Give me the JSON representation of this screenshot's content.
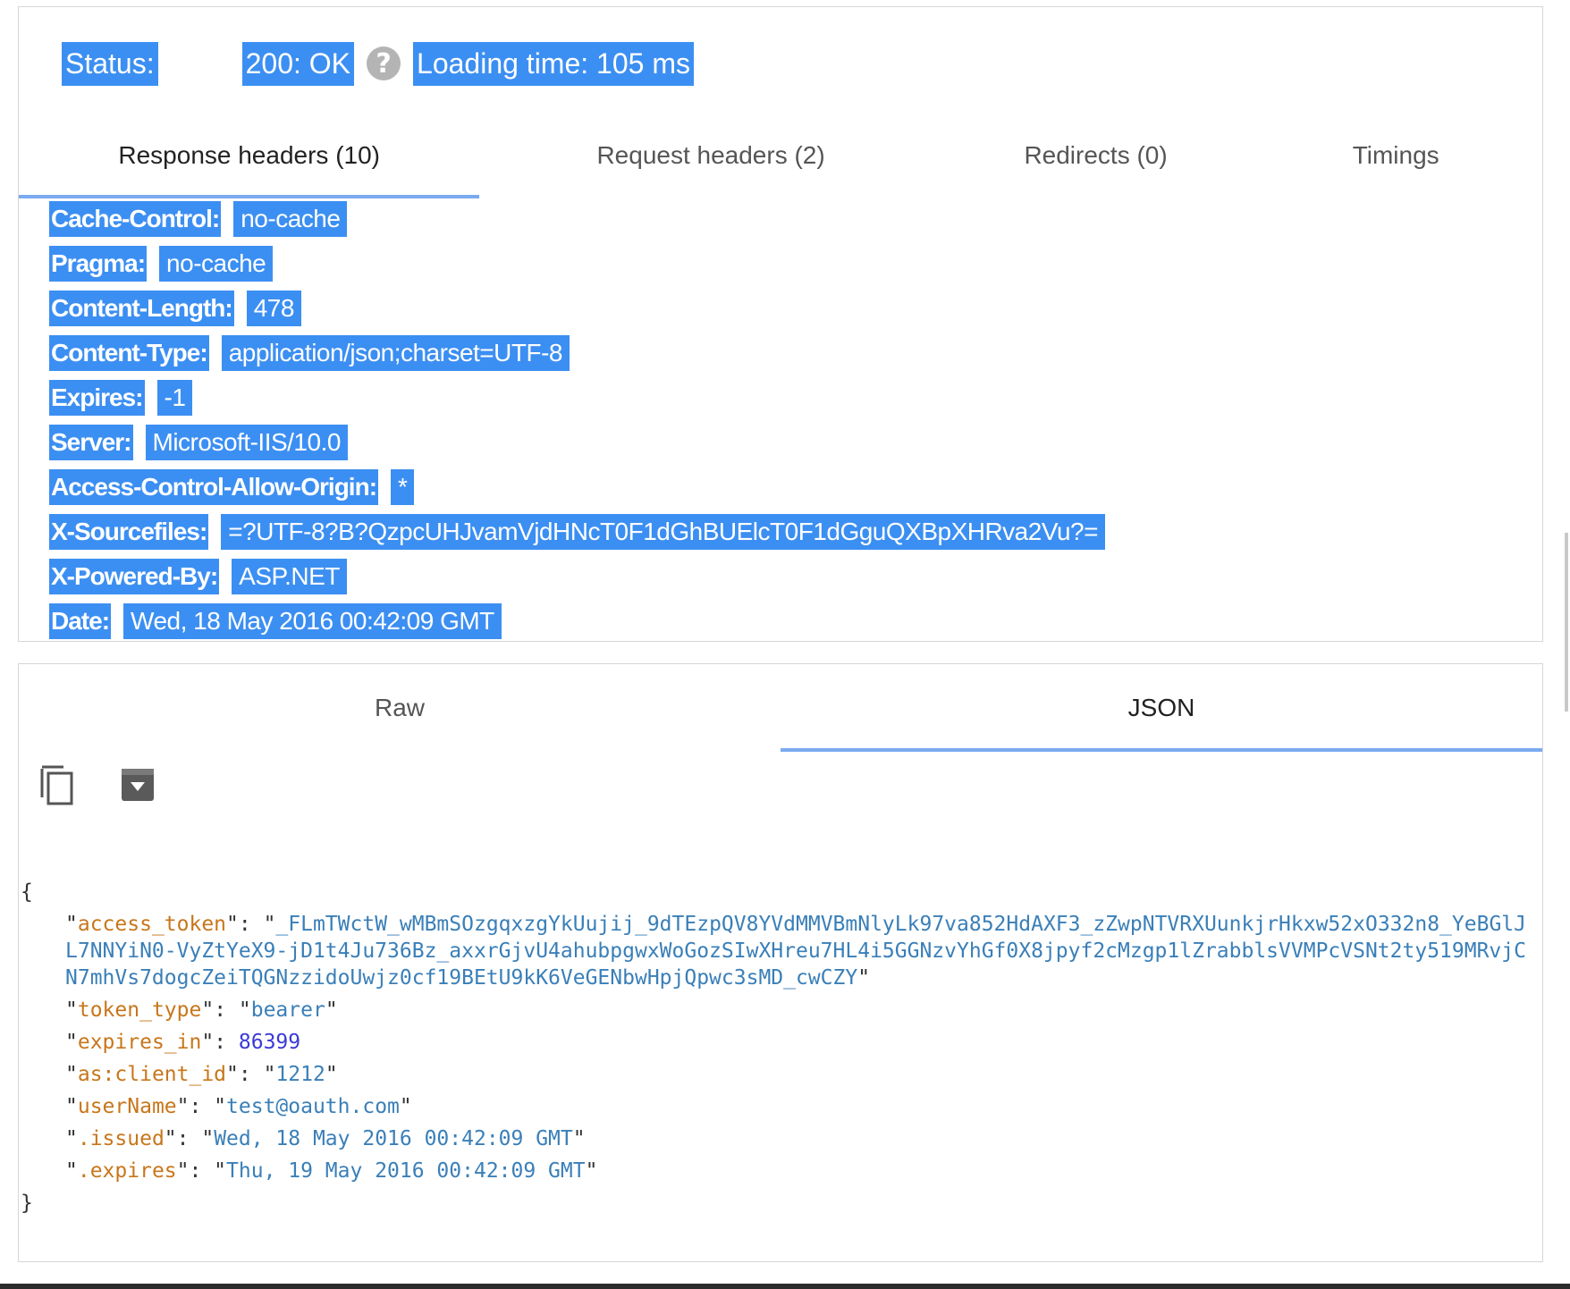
{
  "status": {
    "label": "Status:",
    "code": "200: OK",
    "help_glyph": "?",
    "loading_time": "Loading time: 105 ms"
  },
  "header_tabs": [
    {
      "label": "Response headers (10)",
      "active": true
    },
    {
      "label": "Request headers (2)",
      "active": false
    },
    {
      "label": "Redirects (0)",
      "active": false
    },
    {
      "label": "Timings",
      "active": false
    }
  ],
  "response_headers": [
    {
      "name": "Cache-Control:",
      "value": "no-cache"
    },
    {
      "name": "Pragma:",
      "value": "no-cache"
    },
    {
      "name": "Content-Length:",
      "value": "478"
    },
    {
      "name": "Content-Type:",
      "value": "application/json;charset=UTF-8"
    },
    {
      "name": "Expires:",
      "value": "-1"
    },
    {
      "name": "Server:",
      "value": "Microsoft-IIS/10.0"
    },
    {
      "name": "Access-Control-Allow-Origin:",
      "value": "*"
    },
    {
      "name": "X-Sourcefiles:",
      "value": "=?UTF-8?B?QzpcUHJvamVjdHNcT0F1dGhBUElcT0F1dGguQXBpXHRva2Vu?="
    },
    {
      "name": "X-Powered-By:",
      "value": "ASP.NET"
    },
    {
      "name": "Date:",
      "value": "Wed, 18 May 2016 00:42:09 GMT"
    }
  ],
  "body_tabs": [
    {
      "label": "Raw",
      "active": false
    },
    {
      "label": "JSON",
      "active": true
    }
  ],
  "tools": {
    "copy_icon": "copy-icon",
    "save_icon": "save-icon"
  },
  "json_body": {
    "open_brace": "{",
    "close_brace": "}",
    "entries": [
      {
        "key": "access_token",
        "value": "_FLmTWctW_wMBmSOzgqxzgYkUujij_9dTEzpQV8YVdMMVBmNlyLk97va852HdAXF3_zZwpNTVRXUunkjrHkxw52xO332n8_YeBGlJL7NNYiN0-VyZtYeX9-jD1t4Ju736Bz_axxrGjvU4ahubpgwxWoGozSIwXHreu7HL4i5GGNzvYhGf0X8jpyf2cMzgp1lZrabblsVVMPcVSNt2ty519MRvjCN7mhVs7dogcZeiTQGNzzidoUwjz0cf19BEtU9kK6VeGENbwHpjQpwc3sMD_cwCZY",
        "type": "string"
      },
      {
        "key": "token_type",
        "value": "bearer",
        "type": "string"
      },
      {
        "key": "expires_in",
        "value": "86399",
        "type": "number"
      },
      {
        "key": "as:client_id",
        "value": "1212",
        "type": "string"
      },
      {
        "key": "userName",
        "value": "test@oauth.com",
        "type": "string"
      },
      {
        "key": ".issued",
        "value": "Wed, 18 May 2016 00:42:09 GMT",
        "type": "string"
      },
      {
        "key": ".expires",
        "value": "Thu, 19 May 2016 00:42:09 GMT",
        "type": "string"
      }
    ]
  },
  "colors": {
    "selection": "#3c8ff2",
    "tab_underline": "#7aaaf0",
    "json_key": "#c8761b",
    "json_string": "#3a7fb8",
    "json_number": "#3a3ad6"
  }
}
